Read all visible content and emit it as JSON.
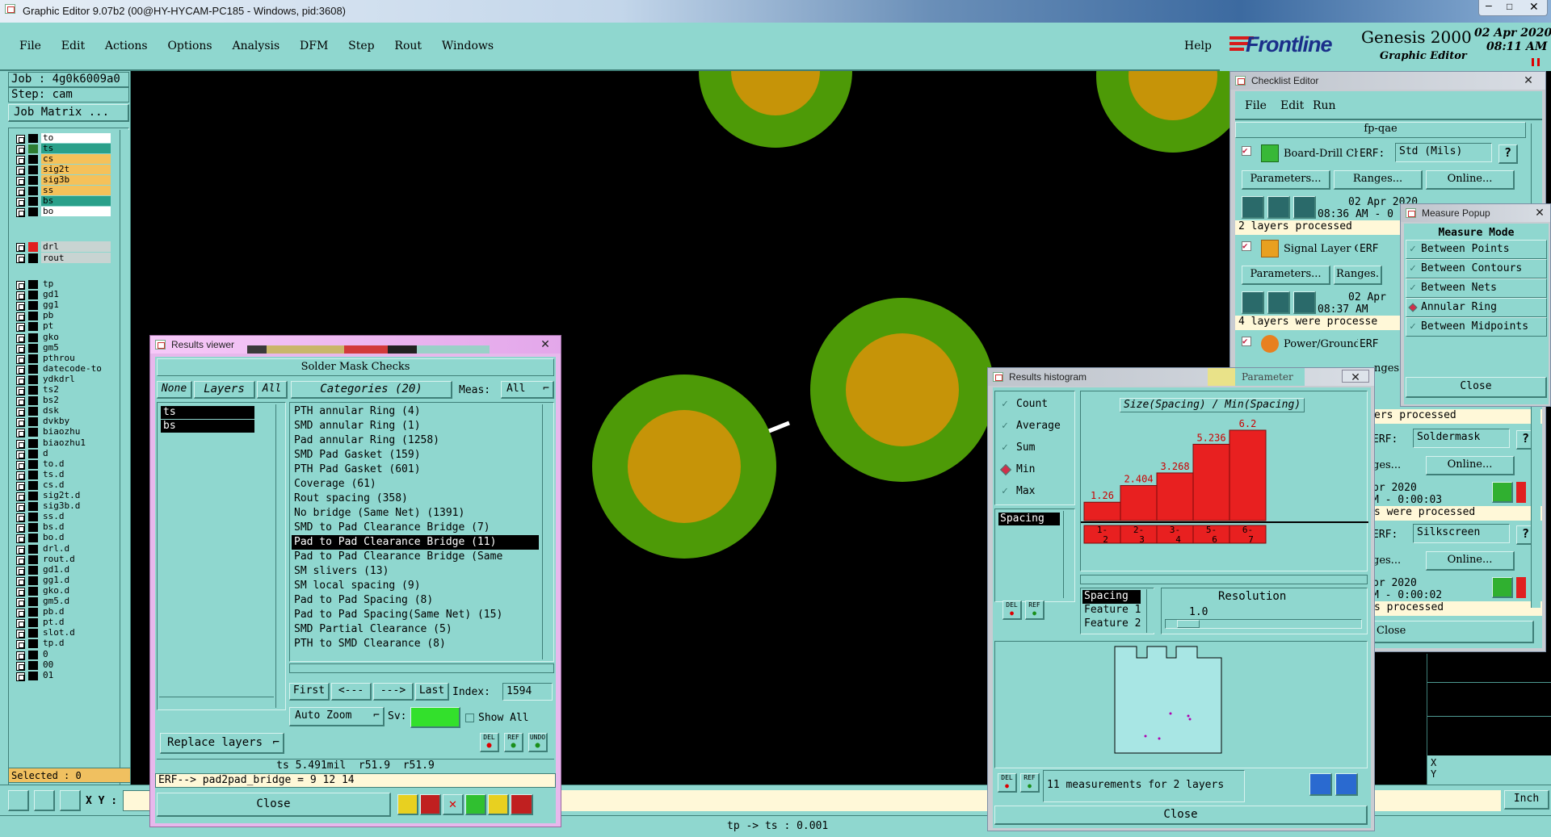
{
  "window": {
    "title": "Graphic Editor 9.07b2 (00@HY-HYCAM-PC185 - Windows, pid:3608)"
  },
  "menu": [
    "File",
    "Edit",
    "Actions",
    "Options",
    "Analysis",
    "DFM",
    "Step",
    "Rout",
    "Windows"
  ],
  "help": "Help",
  "brand": {
    "logo": "Frontline",
    "product": "Genesis 2000",
    "subtitle": "Graphic Editor",
    "date": "02 Apr 2020",
    "time": "08:11 AM"
  },
  "job": {
    "job": "Job : 4g0k6009a0",
    "step": "Step: cam",
    "matrix": "Job Matrix ..."
  },
  "layers_group1": [
    {
      "name": "to",
      "color": "#ffffff",
      "swatch": "#000000"
    },
    {
      "name": "ts",
      "color": "#2aa08a",
      "swatch": "#2e7d32"
    },
    {
      "name": "cs",
      "color": "#f5c15a",
      "swatch": "#000000"
    },
    {
      "name": "sig2t",
      "color": "#f5c15a",
      "swatch": "#000000"
    },
    {
      "name": "sig3b",
      "color": "#f5c15a",
      "swatch": "#000000"
    },
    {
      "name": "ss",
      "color": "#f5c15a",
      "swatch": "#000000"
    },
    {
      "name": "bs",
      "color": "#2aa08a",
      "swatch": "#000000"
    },
    {
      "name": "bo",
      "color": "#ffffff",
      "swatch": "#000000"
    }
  ],
  "layers_group2": [
    {
      "name": "drl",
      "color": "#c8d4d2",
      "swatch": "#e02020"
    },
    {
      "name": "rout",
      "color": "#c8d4d2",
      "swatch": "#000000"
    }
  ],
  "layers_group3": [
    "tp",
    "gd1",
    "gg1",
    "pb",
    "pt",
    "gko",
    "gm5",
    "pthrou",
    "datecode-to",
    "ydkdrl",
    "ts2",
    "bs2",
    "dsk",
    "dvkby",
    "biaozhu",
    "biaozhu1",
    "d",
    "to.d",
    "ts.d",
    "cs.d",
    "sig2t.d",
    "sig3b.d",
    "ss.d",
    "bs.d",
    "bo.d",
    "drl.d",
    "rout.d",
    "gd1.d",
    "gg1.d",
    "gko.d",
    "gm5.d",
    "pb.d",
    "pt.d",
    "slot.d",
    "tp.d",
    "0",
    "00",
    "01"
  ],
  "selected": "Selected : 0",
  "xy_label": "X Y :",
  "status_bar": "tp -> ts : 0.001",
  "units": "Inch",
  "results_viewer": {
    "title": "Results viewer",
    "heading": "Solder Mask Checks",
    "none_btn": "None",
    "layers_btn": "Layers",
    "all_btn": "All",
    "categories_label": "Categories (20)",
    "meas_label": "Meas:",
    "meas_value": "All",
    "layers": [
      "ts",
      "bs"
    ],
    "categories": [
      "PTH annular Ring (4)",
      "SMD annular Ring (1)",
      "Pad annular Ring (1258)",
      "SMD Pad Gasket (159)",
      "PTH Pad Gasket (601)",
      "Coverage (61)",
      "Rout spacing (358)",
      "No bridge (Same Net) (1391)",
      "SMD to Pad Clearance Bridge (7)",
      "Pad to Pad Clearance Bridge (11)",
      "Pad to Pad Clearance Bridge (Same",
      "SM slivers (13)",
      "SM local spacing (9)",
      "Pad to Pad Spacing (8)",
      "Pad to Pad Spacing(Same Net) (15)",
      "SMD Partial Clearance (5)",
      "PTH to SMD Clearance (8)"
    ],
    "selected_category": 9,
    "nav": {
      "first": "First",
      "prev": "<---",
      "next": "--->",
      "last": "Last",
      "index_label": "Index:",
      "index_value": "1594"
    },
    "auto_zoom": "Auto Zoom",
    "sv_label": "Sv:",
    "show_all": "Show All",
    "replace_layers": "Replace layers",
    "del": "DEL",
    "ref": "REF",
    "undo": "UNDO",
    "measure_line": "ts 5.491mil  r51.9  r51.9",
    "erf_line": "ERF--> pad2pad_bridge = 9 12 14",
    "close": "Close"
  },
  "checklist": {
    "title": "Checklist Editor",
    "menu": [
      "File",
      "Edit",
      "Run"
    ],
    "name": "fp-qae",
    "items": [
      {
        "label": "Board-Drill Che",
        "erf": "ERF:",
        "erf_value": "Std (Mils)",
        "date": "02 Apr 2020",
        "time": "08:36 AM - 0",
        "status": "2 layers processed"
      },
      {
        "label": "Signal Layer Ch",
        "erf": "ERF",
        "date": "02 Apr",
        "time": "08:37 AM",
        "status": "4 layers were processe"
      },
      {
        "label": "Power/Ground C",
        "erf": "ERF"
      }
    ],
    "params": "Parameters...",
    "ranges": "Ranges...",
    "online": "Online...",
    "ranges_short": "Ranges.",
    "ranges_frag": "nges.",
    "frag_rows": [
      {
        "status": "ers processed",
        "erf": "ERF:",
        "erf_value": "Soldermask",
        "date": "pr 2020",
        "time": "M - 0:00:03",
        "status2": "s were processed"
      },
      {
        "erf": "ERF:",
        "erf_value": "Silkscreen",
        "date": "pr 2020",
        "time": "M - 0:00:02",
        "status2": "s processed"
      }
    ],
    "frag_ges": "ges...",
    "close": "Close"
  },
  "measure_popup": {
    "title": "Measure Popup",
    "heading": "Measure Mode",
    "options": [
      "Between Points",
      "Between Contours",
      "Between Nets",
      "Annular Ring",
      "Between Midpoints"
    ],
    "selected": 3,
    "close": "Close"
  },
  "histogram": {
    "title": "Results histogram",
    "modes": [
      "Count",
      "Average",
      "Sum",
      "Min",
      "Max"
    ],
    "selected_mode": 3,
    "list_item": "Spacing",
    "chart_title": "Size(Spacing) / Min(Spacing)",
    "resolution_label": "Resolution",
    "resolution_value": "1.0",
    "info_list": [
      "Spacing",
      "Feature 1",
      "Feature 2"
    ],
    "summary": "11 measurements for 2 layers",
    "close": "Close",
    "del": "DEL",
    "ref": "REF"
  },
  "chart_data": {
    "type": "bar",
    "title": "Size(Spacing) / Min(Spacing)",
    "categories": [
      "1-2",
      "2-3",
      "3-4",
      "5-6",
      "6-7"
    ],
    "values": [
      1.26,
      2.404,
      3.268,
      5.236,
      6.2
    ],
    "ylim": [
      0,
      6.2
    ],
    "color": "#e82020"
  },
  "colors": {
    "pad_outer": "#4d9a07",
    "pad_inner": "#c69408",
    "teal": "#8fd7cf",
    "accent_red": "#e02020"
  },
  "param_frag": "Parameter"
}
